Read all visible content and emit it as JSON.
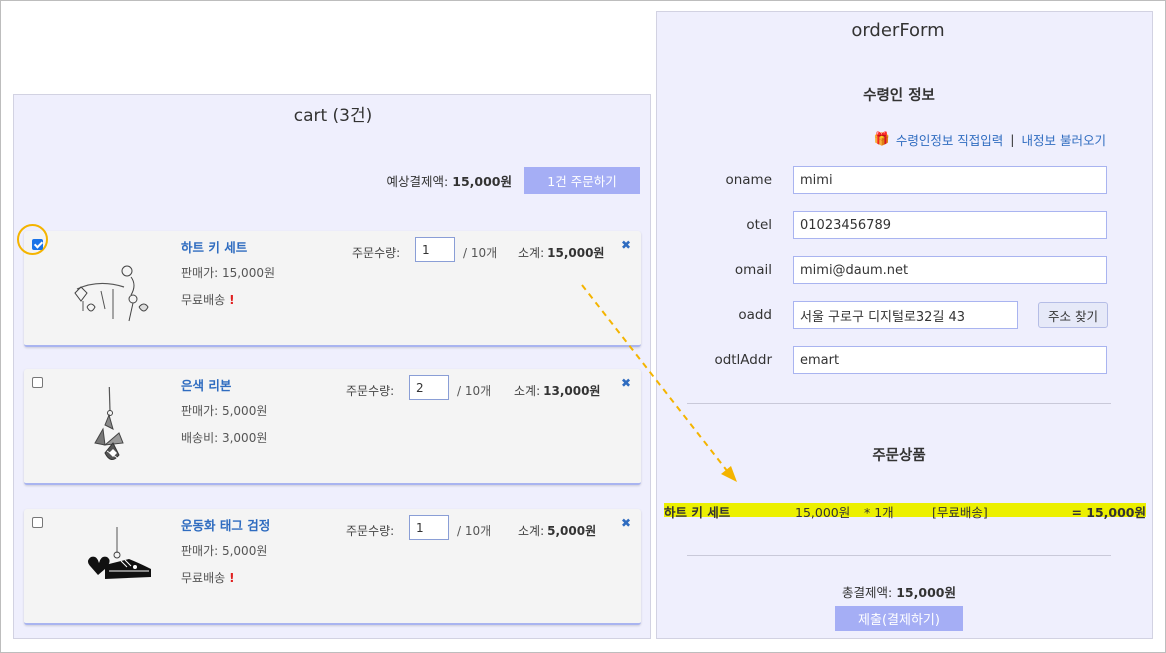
{
  "cart": {
    "title": "cart (3건)",
    "summary_label": "예상결제액:",
    "summary_amount": "15,000원",
    "order_button": "1건 주문하기",
    "items": [
      {
        "name": "하트 키 세트",
        "price": "판매가: 15,000원",
        "shipping": "무료배송",
        "shipping_alert": "!",
        "qty_label": "주문수량:",
        "qty": "1",
        "qty_max": "/ 10개",
        "subtotal_label": "소계:",
        "subtotal": "15,000원",
        "checked": true
      },
      {
        "name": "은색 리본",
        "price": "판매가: 5,000원",
        "shipping": "배송비: 3,000원",
        "shipping_alert": "",
        "qty_label": "주문수량:",
        "qty": "2",
        "qty_max": "/ 10개",
        "subtotal_label": "소계:",
        "subtotal": "13,000원",
        "checked": false
      },
      {
        "name": "운동화 태그 검정",
        "price": "판매가: 5,000원",
        "shipping": "무료배송",
        "shipping_alert": "!",
        "qty_label": "주문수량:",
        "qty": "1",
        "qty_max": "/ 10개",
        "subtotal_label": "소계:",
        "subtotal": "5,000원",
        "checked": false
      }
    ],
    "delete_icon": "close-x-icon"
  },
  "form": {
    "title": "orderForm",
    "recipient_heading": "수령인 정보",
    "link_direct": "수령인정보 직접입력",
    "link_separator": "|",
    "link_load": "내정보 불러오기",
    "fields": {
      "oname": {
        "label": "oname",
        "value": "mimi"
      },
      "otel": {
        "label": "otel",
        "value": "01023456789"
      },
      "omail": {
        "label": "omail",
        "value": "mimi@daum.net"
      },
      "oadd": {
        "label": "oadd",
        "value": "서울 구로구 디지털로32길 43"
      },
      "odtlAddr": {
        "label": "odtlAddr",
        "value": "emart"
      }
    },
    "address_button": "주소 찾기",
    "products_heading": "주문상품",
    "product_row": {
      "name": "하트 키 세트",
      "price": "15,000원",
      "qty": "* 1개",
      "shipping": "[무료배송]",
      "total": "= 15,000원"
    },
    "total_label": "총결제액:",
    "total_amount": "15,000원",
    "submit_button": "제출(결제하기)"
  },
  "colors": {
    "panel_bg": "#efeffd",
    "button_bg": "#a5aef5",
    "link": "#2f6cc0",
    "highlight": "#ecf000",
    "annotation": "#f4b400"
  }
}
